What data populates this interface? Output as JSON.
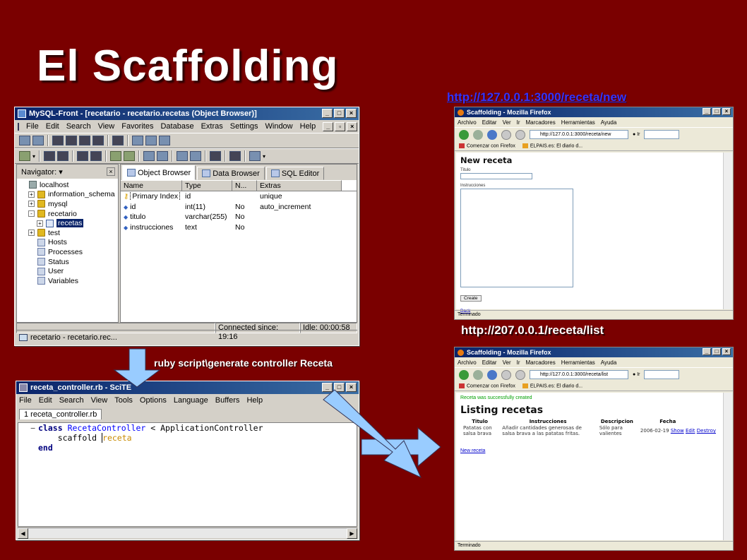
{
  "slide": {
    "title": "El Scaffolding",
    "url_new": "http://127.0.0.1:3000/receta/new",
    "url_list": "http://207.0.0.1/receta/list",
    "command": "ruby script\\generate controller Receta"
  },
  "mysql_front": {
    "title": "MySQL-Front - [recetario - recetario.recetas  (Object Browser)]",
    "menu": [
      "File",
      "Edit",
      "Search",
      "View",
      "Favorites",
      "Database",
      "Extras",
      "Settings",
      "Window",
      "Help"
    ],
    "navigator_label": "Navigator:",
    "tree": [
      {
        "label": "localhost",
        "icon": "server-icon",
        "pm": ""
      },
      {
        "label": "information_schema",
        "icon": "database-icon",
        "pm": "+"
      },
      {
        "label": "mysql",
        "icon": "database-icon",
        "pm": "+"
      },
      {
        "label": "recetario",
        "icon": "database-icon",
        "pm": "-"
      },
      {
        "label": "recetas",
        "icon": "table-icon",
        "pm": "+"
      },
      {
        "label": "test",
        "icon": "database-icon",
        "pm": "+"
      },
      {
        "label": "Hosts",
        "icon": "hosts-icon",
        "pm": ""
      },
      {
        "label": "Processes",
        "icon": "processes-icon",
        "pm": ""
      },
      {
        "label": "Status",
        "icon": "status-icon",
        "pm": ""
      },
      {
        "label": "User",
        "icon": "user-icon",
        "pm": ""
      },
      {
        "label": "Variables",
        "icon": "variables-icon",
        "pm": ""
      }
    ],
    "tabs": [
      "Object Browser",
      "Data Browser",
      "SQL Editor"
    ],
    "columns": [
      "Name",
      "Type",
      "N...",
      "Extras"
    ],
    "rows": [
      {
        "name": "Primary Index",
        "type": "id",
        "n": "",
        "extras": "unique"
      },
      {
        "name": "id",
        "type": "int(11)",
        "n": "No",
        "extras": "auto_increment"
      },
      {
        "name": "titulo",
        "type": "varchar(255)",
        "n": "No",
        "extras": ""
      },
      {
        "name": "instrucciones",
        "type": "text",
        "n": "No",
        "extras": ""
      }
    ],
    "status_connected": "Connected since: 19:16",
    "status_idle": "Idle: 00:00:58",
    "taskbar_item": "recetario - recetario.rec..."
  },
  "scite": {
    "title": "receta_controller.rb - SciTE",
    "menu": [
      "File",
      "Edit",
      "Search",
      "View",
      "Tools",
      "Options",
      "Language",
      "Buffers",
      "Help"
    ],
    "file_tab": "1 receta_controller.rb",
    "code": {
      "l1_kw": "class",
      "l1_cls": "RecetaController",
      "l1_rest": " < ApplicationController",
      "l2_method": "scaffold",
      "l2_sym": "receta",
      "l3_kw": "end"
    }
  },
  "firefox_new": {
    "title": "Scaffolding - Mozilla Firefox",
    "menu": [
      "Archivo",
      "Editar",
      "Ver",
      "Ir",
      "Marcadores",
      "Herramientas",
      "Ayuda"
    ],
    "url": "http://127.0.0.1:3000/receta/new",
    "go_label": "Ir",
    "bookmarks": [
      "Comenzar con Firefox",
      "ELPAIS.es: El diario d..."
    ],
    "heading": "New receta",
    "field_titulo": "Titulo",
    "field_instrucciones": "Instrucciones",
    "create_button": "Create",
    "back_link": "Back",
    "status": "Terminado"
  },
  "firefox_list": {
    "title": "Scaffolding - Mozilla Firefox",
    "menu": [
      "Archivo",
      "Editar",
      "Ver",
      "Ir",
      "Marcadores",
      "Herramientas",
      "Ayuda"
    ],
    "url": "http://127.0.0.1:3000/receta/list",
    "go_label": "Ir",
    "bookmarks": [
      "Comenzar con Firefox",
      "ELPAIS.es: El diario d..."
    ],
    "flash": "Receta was successfully created",
    "heading": "Listing recetas",
    "columns": [
      "Titulo",
      "Instrucciones",
      "Descripcion",
      "Fecha"
    ],
    "row": {
      "titulo": "Patatas con salsa brava",
      "instrucciones": "Añadir cantidades generosas de salsa brava a las patatas fritas.",
      "descripcion": "Sólo para valientes",
      "fecha": "2006-02-19",
      "show": "Show",
      "edit": "Edit",
      "destroy": "Destroy"
    },
    "new_link": "New receta",
    "status": "Terminado"
  },
  "colors": {
    "background": "#7a0000",
    "titlebar": "#0a246a",
    "arrow_fill": "#99ccff"
  }
}
